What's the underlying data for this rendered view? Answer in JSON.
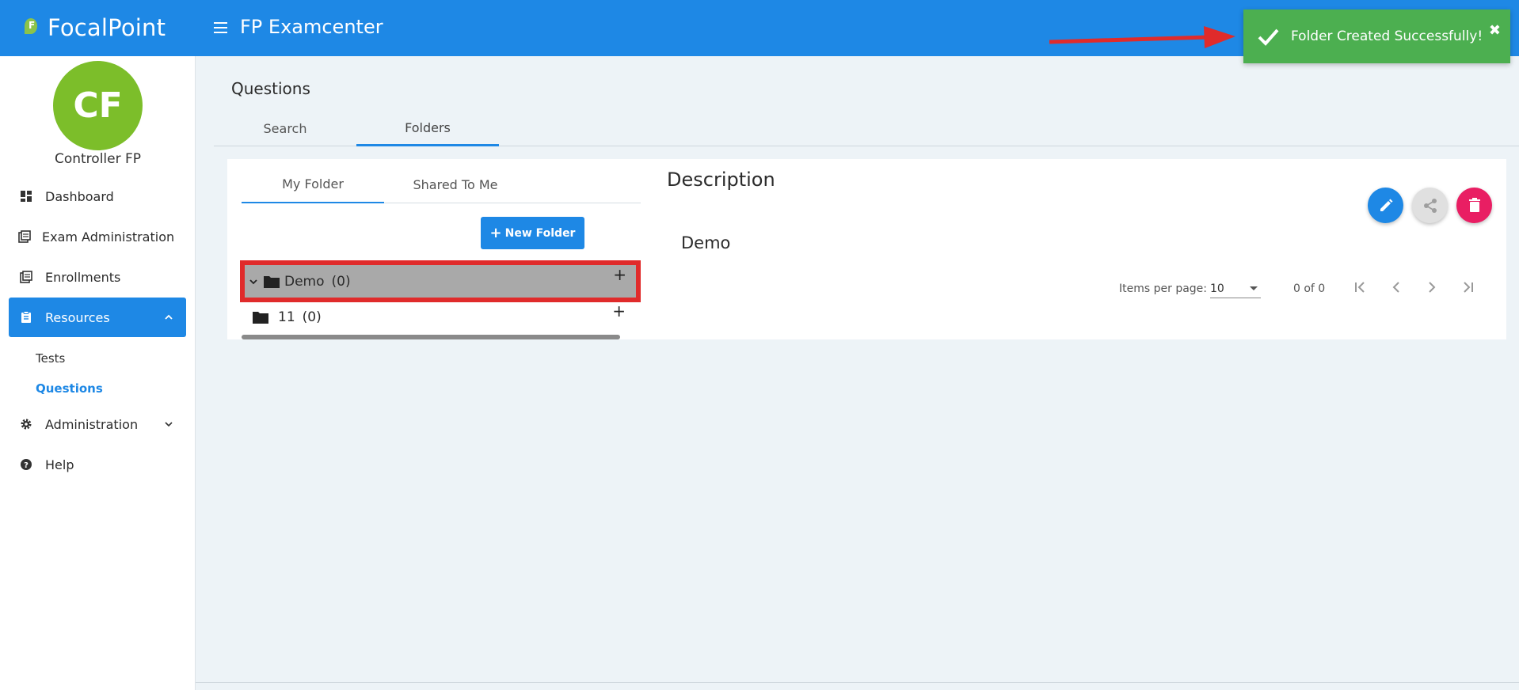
{
  "header": {
    "logo_text": "FocalPoint",
    "app_title": "FP Examcenter"
  },
  "toast": {
    "message": "Folder Created Successfully!",
    "close_glyph": "✖",
    "color": "#4caf50"
  },
  "user": {
    "initials": "CF",
    "name": "Controller FP"
  },
  "sidebar": {
    "items": [
      {
        "label": "Dashboard",
        "icon": "dashboard-icon"
      },
      {
        "label": "Exam Administration",
        "icon": "book-icon"
      },
      {
        "label": "Enrollments",
        "icon": "book-icon"
      },
      {
        "label": "Resources",
        "icon": "clipboard-icon",
        "active": true
      },
      {
        "label": "Administration",
        "icon": "gear-icon"
      },
      {
        "label": "Help",
        "icon": "help-icon"
      }
    ],
    "sub_items": [
      {
        "label": "Tests"
      },
      {
        "label": "Questions",
        "active": true
      }
    ]
  },
  "main": {
    "page_title": "Questions",
    "tabs": [
      {
        "label": "Search"
      },
      {
        "label": "Folders",
        "active": true
      }
    ],
    "folder_tabs": [
      {
        "label": "My Folder",
        "active": true
      },
      {
        "label": "Shared To Me"
      }
    ],
    "new_folder_label": "New Folder",
    "folders": [
      {
        "name": "Demo",
        "count": "(0)",
        "selected": true,
        "expanded": true
      },
      {
        "name": "11",
        "count": "(0)"
      }
    ],
    "description_title": "Description",
    "description_text": "Demo",
    "pager": {
      "items_per_page_label": "Items per page:",
      "items_per_page": "10",
      "range": "0 of 0"
    }
  },
  "colors": {
    "primary": "#1e88e5",
    "avatar": "#7cbe2a",
    "delete": "#e91e63",
    "highlight_border": "#e02b2b"
  }
}
